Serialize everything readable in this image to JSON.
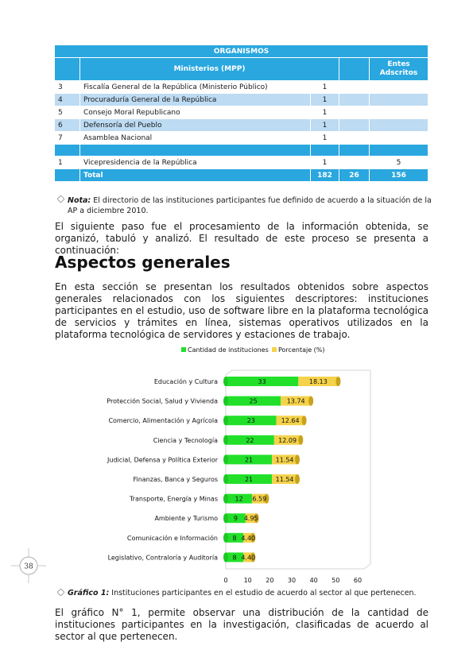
{
  "table": {
    "header_top": "ORGANISMOS",
    "header_ministerios": "Ministerios (MPP)",
    "header_entes": "Entes Adscritos",
    "rows": [
      {
        "n": "3",
        "name": "Fiscalía General de la República (Ministerio Público)",
        "a": "1",
        "b": "",
        "style": "white"
      },
      {
        "n": "4",
        "name": "Procuraduría General de la República",
        "a": "1",
        "b": "",
        "style": "blue"
      },
      {
        "n": "5",
        "name": "Consejo Moral Republicano",
        "a": "1",
        "b": "",
        "style": "white"
      },
      {
        "n": "6",
        "name": "Defensoría del Pueblo",
        "a": "1",
        "b": "",
        "style": "blue"
      },
      {
        "n": "7",
        "name": "Asamblea Nacional",
        "a": "1",
        "b": "",
        "style": "white"
      },
      {
        "n": "1",
        "name": "Vicepresidencia de la República",
        "a": "1",
        "b": "5",
        "style": "white"
      }
    ],
    "total_label": "Total",
    "total_values": [
      "182",
      "26",
      "156"
    ]
  },
  "note": {
    "label": "Nota:",
    "text": " El directorio de las instituciones participantes fue definido de acuerdo a la situación de la AP a diciembre 2010."
  },
  "para1": "El siguiente paso fue el procesamiento de la información obtenida, se organizó, tabuló y analizó. El resultado de este proceso se presenta a continuación:",
  "section_heading": "Aspectos generales",
  "para2": "En esta sección se presentan los resultados obtenidos sobre aspectos generales relacionados con los siguientes descriptores: instituciones participantes en el estudio, uso de software libre en la plataforma tecnológica de servicios y trámites en línea, sistemas operativos utilizados en la plataforma tecnológica de servidores y estaciones de trabajo.",
  "chart_data": {
    "type": "bar",
    "orientation": "horizontal",
    "stacked": true,
    "categories": [
      "Educación y Cultura",
      "Protección Social, Salud y Vivienda",
      "Comercio, Alimentación y Agrícola",
      "Ciencia y Tecnología",
      "Judicial, Defensa y Política Exterior",
      "Finanzas, Banca y Seguros",
      "Transporte, Energía y Minas",
      "Ambiente y Turismo",
      "Comunicación e Información",
      "Legislativo, Contraloría y Auditoría"
    ],
    "series": [
      {
        "name": "Cantidad de instituciones",
        "values": [
          33,
          25,
          23,
          22,
          21,
          21,
          12,
          9,
          8,
          8
        ],
        "labels": [
          "33",
          "25",
          "23",
          "22",
          "21",
          "21",
          "12",
          "9",
          "8",
          "8"
        ],
        "color": "#22e02a"
      },
      {
        "name": "Porcentaje (%)",
        "values": [
          18.13,
          13.74,
          12.64,
          12.09,
          11.54,
          11.54,
          6.59,
          4.95,
          4.4,
          4.4
        ],
        "labels": [
          "18.13",
          "13.74",
          "12.64",
          "12.09",
          "11.54",
          "11.54",
          "6.59",
          "4.95",
          "4.40",
          "4.40"
        ],
        "color": "#f4d24a"
      }
    ],
    "xlim": [
      0,
      60
    ],
    "xticks": [
      "0",
      "10",
      "20",
      "30",
      "40",
      "50",
      "60"
    ],
    "legend_position": "top",
    "grid": false
  },
  "caption": {
    "label": "Gráfico 1:",
    "text": " Instituciones participantes en el estudio de acuerdo al sector al que pertenecen."
  },
  "para3": "El gráfico N° 1, permite observar una distribución de la cantidad de instituciones participantes en la investigación, clasificadas de acuerdo al sector al que pertenecen.",
  "page_number": "38"
}
